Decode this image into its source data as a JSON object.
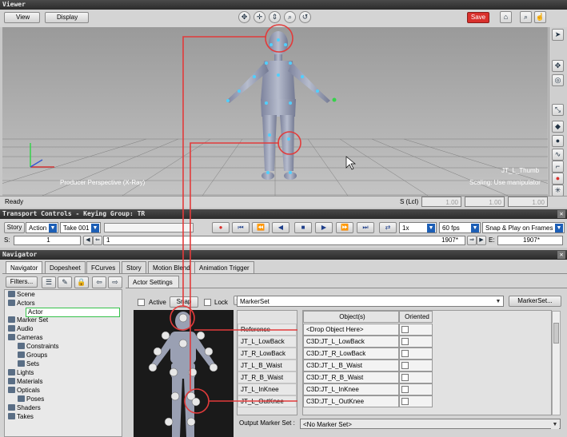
{
  "viewer": {
    "title": "Viewer",
    "view_label": "View",
    "display_label": "Display",
    "save_label": "Save",
    "viewport_label": "Producer Perspective (X-Ray)",
    "selection_label": "JT_L_Thumb",
    "scaling_label": "Scaling: Use manipulator",
    "status": "Ready",
    "s_lcl_label": "S (Lcl)",
    "scale_x": "1.00",
    "scale_y": "1.00",
    "scale_z": "1.00"
  },
  "transport": {
    "title": "Transport Controls  -  Keying Group: TR",
    "story_label": "Story",
    "action_label": "Action",
    "take_label": "Take 001",
    "speed": "1x",
    "fps": "60 fps",
    "snap": "Snap & Play on Frames",
    "s_label": "S:",
    "s_value": "1",
    "frame_start": "1",
    "frame_end": "1907*",
    "e_label": "E:",
    "e_value": "1907*"
  },
  "navigator": {
    "title": "Navigator",
    "tabs": [
      "Navigator",
      "Dopesheet",
      "FCurves",
      "Story",
      "Motion Blend",
      "Animation Trigger"
    ],
    "filters_label": "Filters...",
    "tree": [
      "Scene",
      "Actors",
      "Actor",
      "Marker Set",
      "Audio",
      "Cameras",
      "Constraints",
      "Groups",
      "Sets",
      "Lights",
      "Materials",
      "Opticals",
      "Poses",
      "Shaders",
      "Takes"
    ],
    "actor_settings_tab": "Actor Settings",
    "active_label": "Active",
    "snap_label": "Snap",
    "lock_label": "Lock",
    "markerset_select": "MarkerSet",
    "markerset_button": "MarkerSet...",
    "table_headers": [
      "Object(s)",
      "Oriented"
    ],
    "rows": [
      {
        "label": "Reference",
        "object": "<Drop Object Here>"
      },
      {
        "label": "JT_L_LowBack",
        "object": "C3D:JT_L_LowBack"
      },
      {
        "label": "JT_R_LowBack",
        "object": "C3D:JT_R_LowBack"
      },
      {
        "label": "JT_L_B_Waist",
        "object": "C3D:JT_L_B_Waist"
      },
      {
        "label": "JT_R_B_Waist",
        "object": "C3D:JT_R_B_Waist"
      },
      {
        "label": "JT_L_InKnee",
        "object": "C3D:JT_L_InKnee"
      },
      {
        "label": "JT_L_OutKnee",
        "object": "C3D:JT_L_OutKnee"
      }
    ],
    "output_label": "Output Marker Set :",
    "output_value": "<No Marker Set>"
  },
  "colors": {
    "accent": "#1d5fb6",
    "save": "#d9302c",
    "annotation": "#e23b3b",
    "marker": "#4fd0ff"
  }
}
